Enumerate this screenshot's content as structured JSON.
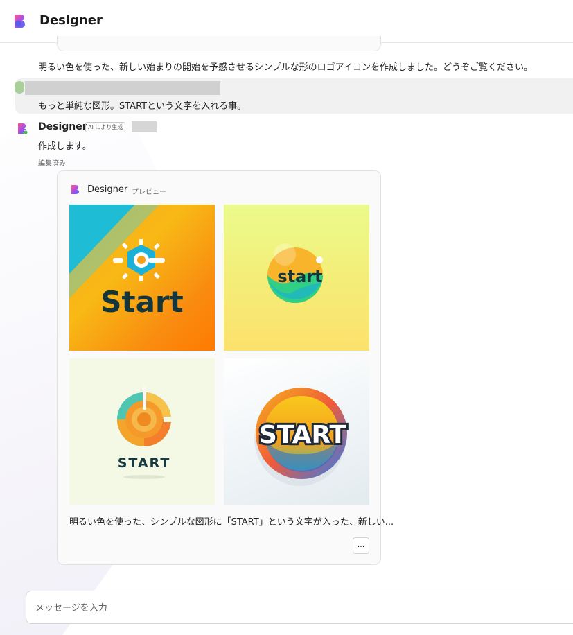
{
  "header": {
    "title": "Designer"
  },
  "conversation": {
    "previous_message": "明るい色を使った、新しい始まりの開始を予感させるシンプルな形のロゴアイコンを作成しました。どうぞご覧ください。",
    "user_message": "もっと単純な図形。STARTという文字を入れる事。",
    "bot": {
      "name": "Designer",
      "badge": "AI により生成",
      "message": "作成します。",
      "edited_label": "編集済み"
    }
  },
  "card": {
    "title": "Designer",
    "subtitle": "プレビュー",
    "images": [
      {
        "word": "Start",
        "icon": "sun-gear-icon"
      },
      {
        "word": "start",
        "icon": "circle-wave-icon"
      },
      {
        "word": "START",
        "icon": "power-circle-icon"
      },
      {
        "word": "START",
        "icon": "ring-badge-icon"
      }
    ],
    "caption": "明るい色を使った、シンプルな図形に「START」という文字が入った、新しい...",
    "more_label": "..."
  },
  "input": {
    "placeholder": "メッセージを入力"
  },
  "colors": {
    "accent": "#6b4bd8",
    "user_band": "#f1f1f1",
    "card_bg": "#fafafa"
  }
}
